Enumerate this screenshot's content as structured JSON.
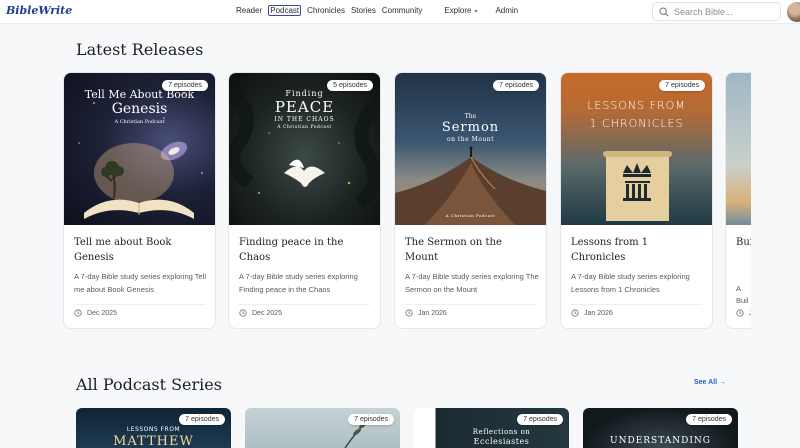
{
  "app": {
    "logo": "BibleWrite"
  },
  "nav": {
    "items": [
      "Reader",
      "Podcast",
      "Chronicles",
      "Stories",
      "Community"
    ],
    "explore": "Explore",
    "admin": "Admin"
  },
  "search": {
    "placeholder": "Search Bible..."
  },
  "latest": {
    "title": "Latest Releases",
    "cards": [
      {
        "badge": "7 episodes",
        "cover_line1": "Tell Me About Book",
        "cover_line2": "Genesis",
        "cover_sub": "A Christian Podcast",
        "title": "Tell me about Book Genesis",
        "desc": "A 7-day Bible study series exploring Tell me about Book Genesis",
        "date": "Dec 2025"
      },
      {
        "badge": "5 episodes",
        "cover_line1": "Finding",
        "cover_line2": "PEACE",
        "cover_line3": "IN THE CHAOS",
        "cover_sub": "A Christian Podcast",
        "title": "Finding peace in the Chaos",
        "desc": "A 7-day Bible study series exploring Finding peace in the Chaos",
        "date": "Dec 2025"
      },
      {
        "badge": "7 episodes",
        "cover_line1": "The",
        "cover_line2": "Sermon",
        "cover_line3": "on the Mount",
        "cover_sub": "A Christian Podcast",
        "title": "The Sermon on the Mount",
        "desc": "A 7-day Bible study series exploring The Sermon on the Mount",
        "date": "Jan 2026"
      },
      {
        "badge": "7 episodes",
        "cover_line1": "LESSONS FROM",
        "cover_line2": "1 CHRONICLES",
        "title": "Lessons from 1 Chronicles",
        "desc": "A 7-day Bible study series exploring Lessons from 1 Chronicles",
        "date": "Jan 2026"
      },
      {
        "title": "Bui",
        "desc_1": "A",
        "desc_2": "Buil",
        "date": "J"
      }
    ]
  },
  "series": {
    "title": "All Podcast Series",
    "see_all": "See All →",
    "cards": [
      {
        "badge": "7 episodes",
        "cover_line1": "LESSONS FROM",
        "cover_line2": "MATTHEW"
      },
      {
        "badge": "7 episodes"
      },
      {
        "badge": "7 episodes",
        "cover_line1": "Reflections on",
        "cover_line2": "Ecclesiastes"
      },
      {
        "badge": "7 episodes",
        "cover_line1": "UNDERSTANDING"
      }
    ]
  },
  "colors": {
    "accent": "#2f5bd3",
    "logo": "#1f3f8f"
  }
}
